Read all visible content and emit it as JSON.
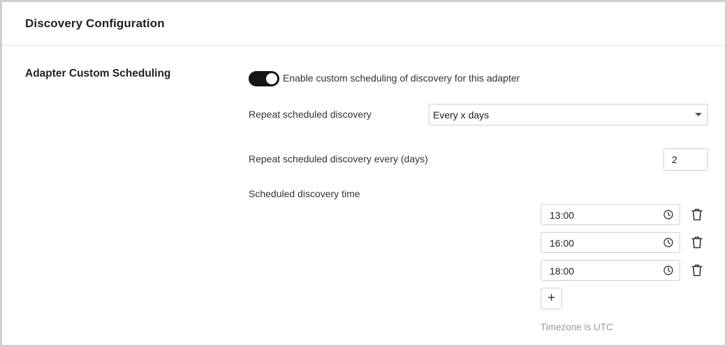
{
  "header": {
    "title": "Discovery Configuration"
  },
  "section": {
    "label": "Adapter Custom Scheduling"
  },
  "toggle": {
    "enabled": true,
    "label": "Enable custom scheduling of discovery for this adapter"
  },
  "repeat": {
    "label": "Repeat scheduled discovery",
    "selected": "Every x days"
  },
  "repeat_every": {
    "label": "Repeat scheduled discovery every (days)",
    "value": "2"
  },
  "schedule": {
    "label": "Scheduled discovery time",
    "times": [
      "13:00",
      "16:00",
      "18:00"
    ],
    "add_label": "+",
    "timezone_note": "Timezone is UTC"
  },
  "icons": {
    "time": "clock-icon",
    "remove": "trash-icon",
    "dropdown": "caret-down-icon"
  }
}
